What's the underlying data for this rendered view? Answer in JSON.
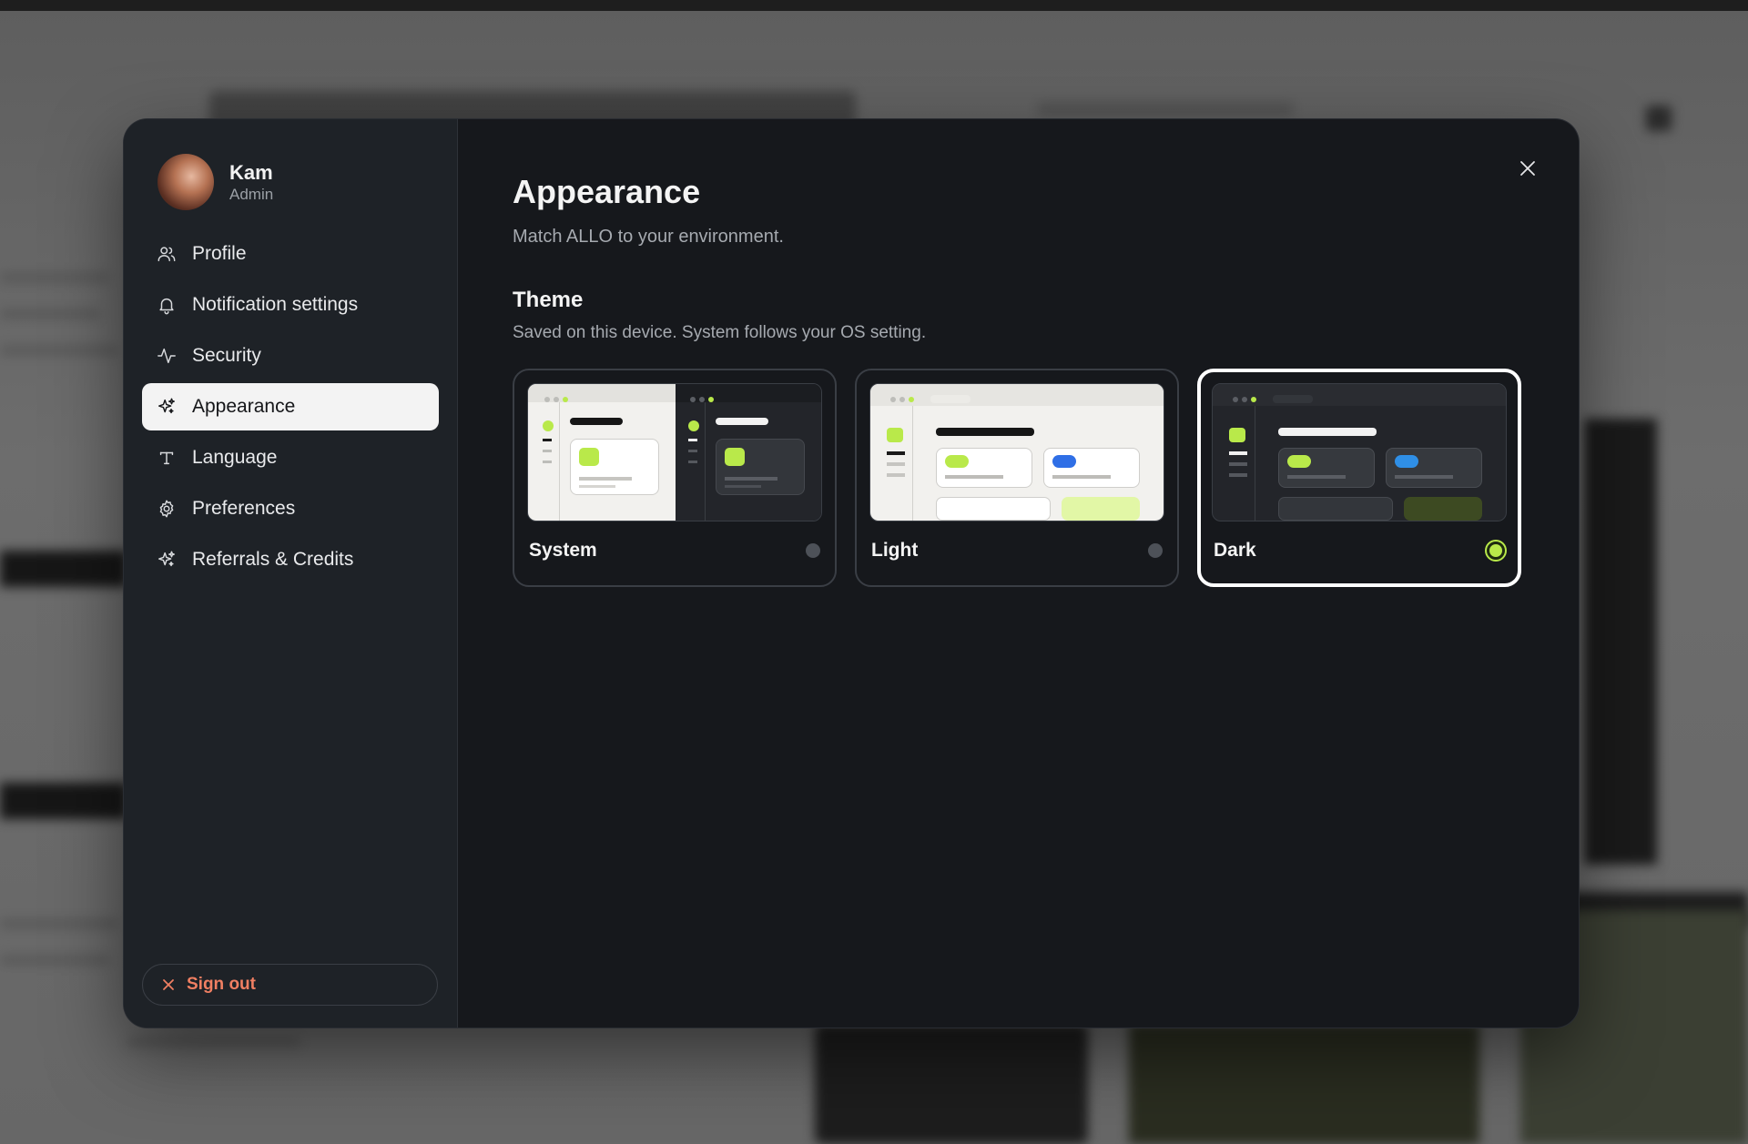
{
  "user": {
    "name": "Kam",
    "role": "Admin"
  },
  "nav": [
    {
      "label": "Profile",
      "icon": "user-group-icon"
    },
    {
      "label": "Notification settings",
      "icon": "bell-icon"
    },
    {
      "label": "Security",
      "icon": "activity-icon"
    },
    {
      "label": "Appearance",
      "icon": "sparkle-icon",
      "active": true
    },
    {
      "label": "Language",
      "icon": "text-t-icon"
    },
    {
      "label": "Preferences",
      "icon": "gear-icon"
    },
    {
      "label": "Referrals & Credits",
      "icon": "sparkle-icon"
    }
  ],
  "signout": {
    "label": "Sign out",
    "icon": "x-icon"
  },
  "page": {
    "title": "Appearance",
    "subtitle": "Match ALLO to your environment."
  },
  "theme": {
    "title": "Theme",
    "subtitle": "Saved on this device. System follows your OS setting.",
    "options": [
      {
        "label": "System",
        "selected": false
      },
      {
        "label": "Light",
        "selected": false
      },
      {
        "label": "Dark",
        "selected": true
      }
    ]
  },
  "colors": {
    "accent_green": "#b9e94a",
    "accent_blue": "#2f6fe6",
    "signout_red": "#f07f62"
  }
}
